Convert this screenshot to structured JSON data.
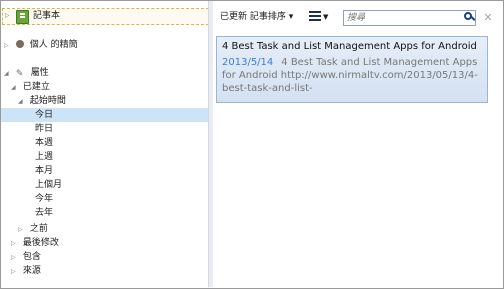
{
  "left_panel": {
    "notebook_label": "記事本",
    "shared_label": "個人 的精簡",
    "attributes_label": "屬性",
    "created_label": "已建立",
    "since_label": "起始時間",
    "time_items": [
      "今日",
      "昨日",
      "本週",
      "上週",
      "本月",
      "上個月",
      "今年",
      "去年"
    ],
    "before_label": "之前",
    "last_modified_label": "最後修改",
    "contains_label": "包含",
    "source_label": "來源"
  },
  "toolbar": {
    "sort_label": "已更新 記事排序 ▾",
    "search_placeholder": "搜尋"
  },
  "notes": [
    {
      "title": "4 Best Task and List Management Apps for Android",
      "date": "2013/5/14",
      "snippet": "4 Best Task and List Management Apps for Android http://www.nirmaltv.com/2013/05/13/4-best-task-and-list-"
    }
  ]
}
